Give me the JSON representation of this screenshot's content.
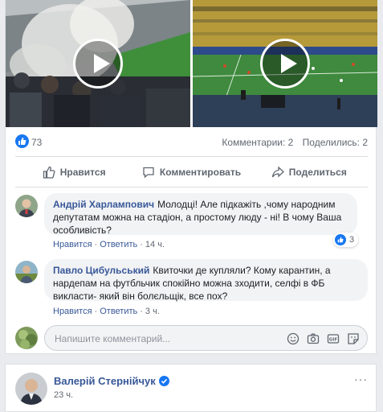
{
  "post": {
    "videos": [
      {
        "name": "stadium-stands-video"
      },
      {
        "name": "football-pitch-video"
      }
    ],
    "likes_count": "73",
    "comments_count": "Комментарии: 2",
    "shares_count": "Поделились: 2",
    "actions": {
      "like": "Нравится",
      "comment": "Комментировать",
      "share": "Поделиться"
    }
  },
  "comments": [
    {
      "author": "Андрій Харлампович",
      "text": "Молодці! Але підкажіть ,чому народним депутатам можна на стадіон, а простому люду - ні! В чому Ваша особливість?",
      "like_label": "Нравится",
      "reply_label": "Ответить",
      "time": "14 ч.",
      "reactions": "3"
    },
    {
      "author": "Павло Цибульський",
      "text": "Квиточки де купляли? Кому карантин, а нардепам на футбльчик спокійно можна зходити, селфі в ФБ викласти- який він болєльщік, все пох?",
      "like_label": "Нравится",
      "reply_label": "Ответить",
      "time": "3 ч."
    }
  ],
  "composer": {
    "placeholder": "Напишите комментарий...",
    "icons": [
      "emoji-icon",
      "camera-icon",
      "gif-icon",
      "sticker-icon"
    ]
  },
  "next_post": {
    "author": "Валерій Стернійчук",
    "time": "23 ч."
  },
  "colors": {
    "link": "#385898",
    "accent": "#1877f2",
    "muted": "#606770",
    "bubble": "#f2f3f5"
  }
}
